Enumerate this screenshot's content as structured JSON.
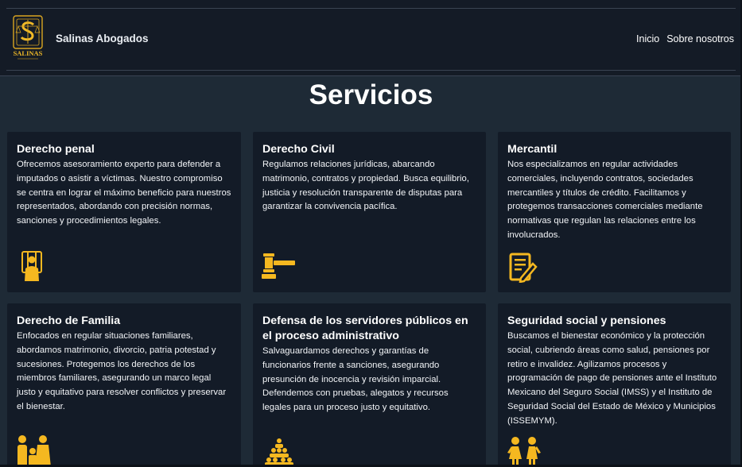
{
  "brand": {
    "name": "Salinas Abogados",
    "logo_text": "SALINAS"
  },
  "nav": {
    "links": [
      "Inicio",
      "Sobre nosotros"
    ]
  },
  "page_title": "Servicios",
  "accent_color": "#f5b820",
  "cards": [
    {
      "title": "Derecho penal",
      "text": "Ofrecemos asesoramiento experto para defender a imputados o asistir a víctimas. Nuestro compromiso se centra en lograr el máximo beneficio para nuestros representados, abordando con precisión normas, sanciones y procedimientos legales.",
      "icon": "prisoner-icon"
    },
    {
      "title": "Derecho Civil",
      "text": "Regulamos relaciones jurídicas, abarcando matrimonio, contratos y propiedad. Busca equilibrio, justicia y resolución transparente de disputas para garantizar la convivencia pacífica.",
      "icon": "gavel-icon"
    },
    {
      "title": "Mercantil",
      "text": "Nos especializamos en regular actividades comerciales, incluyendo contratos, sociedades mercantiles y títulos de crédito. Facilitamos y protegemos transacciones comerciales mediante normativas que regulan las relaciones entre los involucrados.",
      "icon": "contract-icon"
    },
    {
      "title": "Derecho de Familia",
      "text": "Enfocados en regular situaciones familiares, abordamos matrimonio, divorcio, patria potestad y sucesiones. Protegemos los derechos de los miembros familiares, asegurando un marco legal justo y equitativo para resolver conflictos y preservar el bienestar.",
      "icon": "family-icon"
    },
    {
      "title": "Defensa de los servidores públicos en el proceso administrativo",
      "text": "Salvaguardamos derechos y garantías de funcionarios frente a sanciones, asegurando presunción de inocencia y revisión imparcial. Defendemos con pruebas, alegatos y recursos legales para un proceso justo y equitativo.",
      "icon": "group-icon"
    },
    {
      "title": "Seguridad social y pensiones",
      "text": "Buscamos el bienestar económico y la protección social, cubriendo áreas como salud, pensiones por retiro e invalidez. Agilizamos procesos y programación de pago de pensiones ante el Instituto Mexicano del Seguro Social (IMSS) y el Instituto de Seguridad Social del Estado de México y Municipios (ISSEMYM).",
      "icon": "people-icon"
    }
  ]
}
